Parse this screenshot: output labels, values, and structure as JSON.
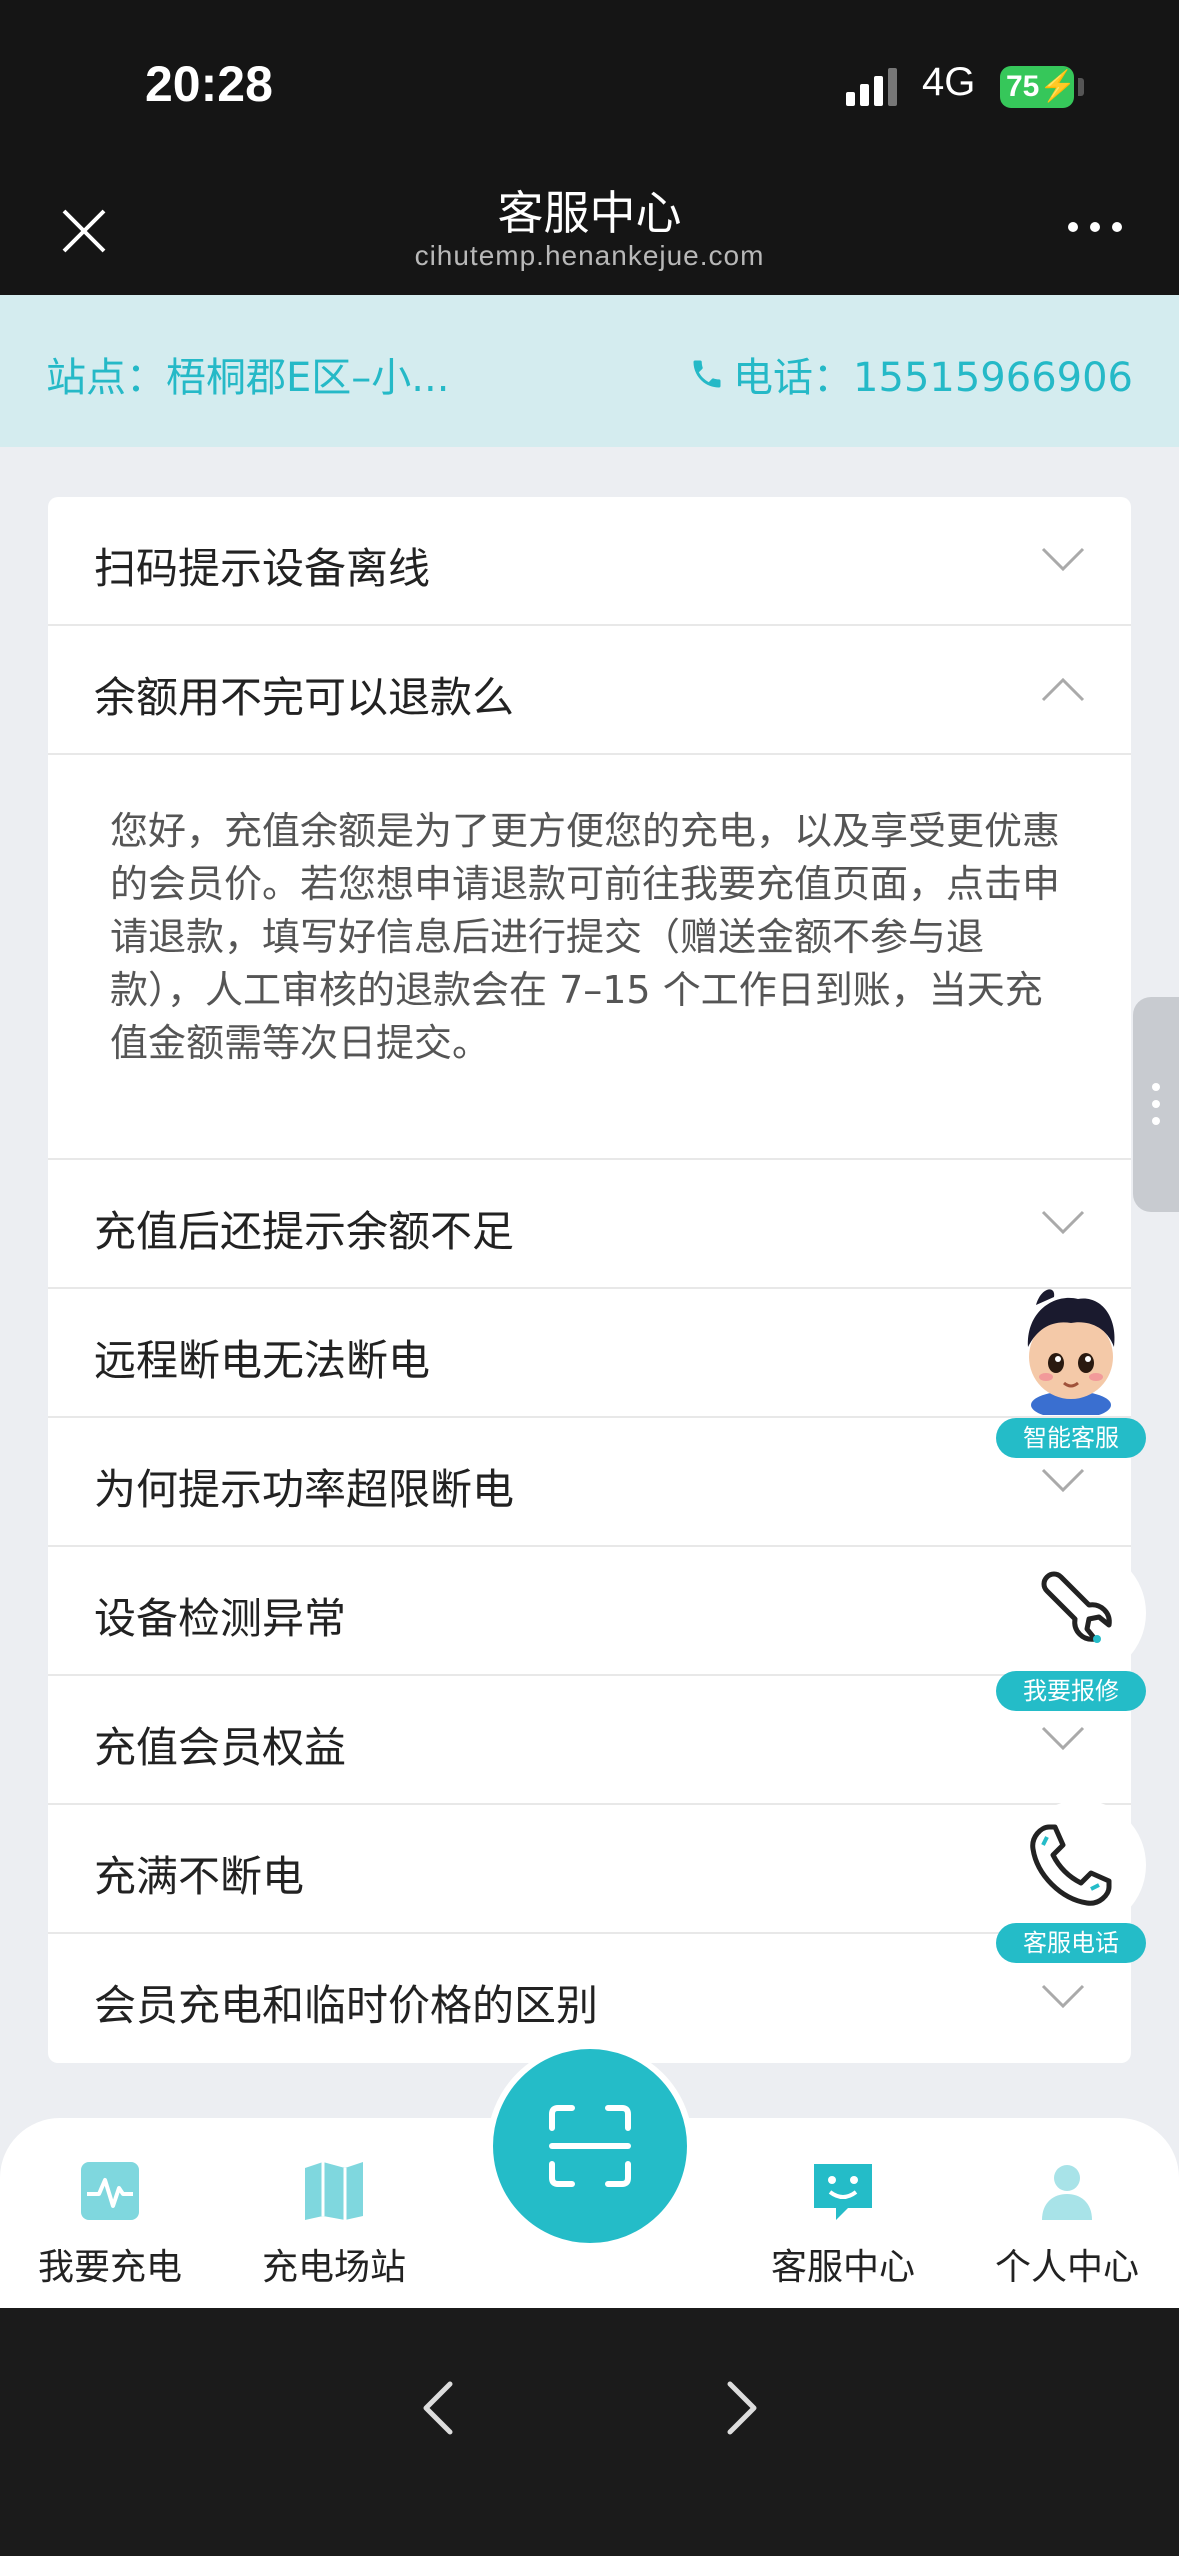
{
  "status_bar": {
    "time": "20:28",
    "network": "4G",
    "battery": "75"
  },
  "nav": {
    "title": "客服中心",
    "url": "cihutemp.henankejue.com"
  },
  "info": {
    "station": "站点：梧桐郡E区–小...",
    "phone": "电话：15515966906"
  },
  "faq": {
    "items": [
      {
        "question": "扫码提示设备离线",
        "expanded": false
      },
      {
        "question": "余额用不完可以退款么",
        "expanded": true
      },
      {
        "question": "充值后还提示余额不足",
        "expanded": false
      },
      {
        "question": "远程断电无法断电",
        "expanded": false
      },
      {
        "question": "为何提示功率超限断电",
        "expanded": false
      },
      {
        "question": "设备检测异常",
        "expanded": false
      },
      {
        "question": "充值会员权益",
        "expanded": false
      },
      {
        "question": "充满不断电",
        "expanded": false
      },
      {
        "question": "会员充电和临时价格的区别",
        "expanded": false
      }
    ],
    "answer": "您好，充值余额是为了更方便您的充电，以及享受更优惠的会员价。若您想申请退款可前往我要充值页面，点击申请退款，填写好信息后进行提交（赠送金额不参与退款），人工审核的退款会在 7–15 个工作日到账，当天充值金额需等次日提交。"
  },
  "floating": {
    "ai_service": "智能客服",
    "repair": "我要报修",
    "service_phone": "客服电话"
  },
  "tabs": {
    "charge": "我要充电",
    "stations": "充电场站",
    "service": "客服中心",
    "profile": "个人中心"
  },
  "colors": {
    "accent": "#24bcc8",
    "info_bg": "#d4ecef",
    "page_bg": "#eceef2"
  }
}
